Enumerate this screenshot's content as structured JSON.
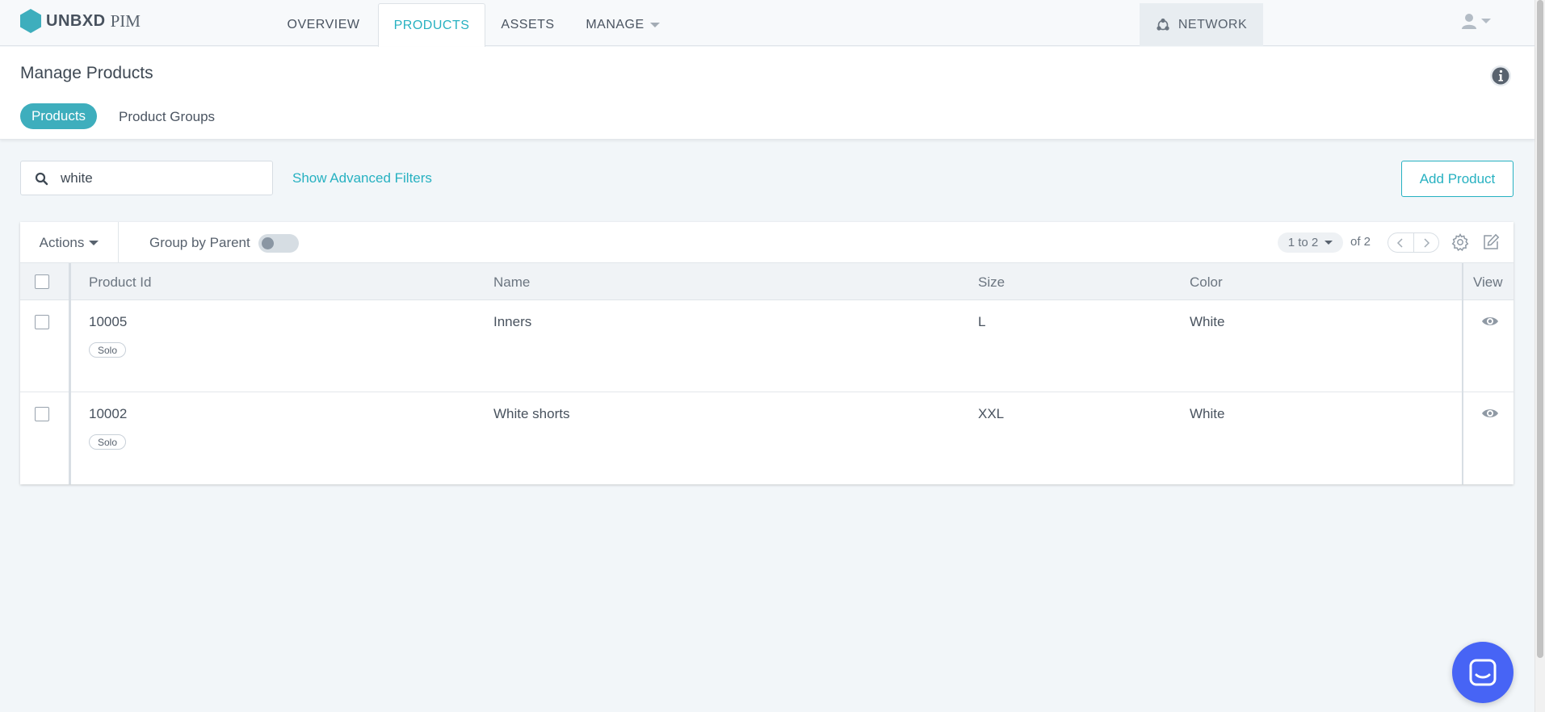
{
  "topnav": {
    "brand": "UNBXD",
    "product": "PIM",
    "tabs": [
      {
        "label": "OVERVIEW"
      },
      {
        "label": "PRODUCTS"
      },
      {
        "label": "ASSETS"
      },
      {
        "label": "MANAGE"
      }
    ],
    "active_tab": "PRODUCTS",
    "network_label": "NETWORK",
    "accent_color": "#27b1c1",
    "brand_color": "#3eaebd"
  },
  "header": {
    "title": "Manage Products",
    "subtabs": [
      {
        "label": "Products"
      },
      {
        "label": "Product Groups"
      }
    ],
    "active_subtab": "Products"
  },
  "filters": {
    "search_value": "white",
    "advanced_filters_label": "Show Advanced Filters",
    "add_button_label": "Add Product"
  },
  "grid": {
    "actions_label": "Actions",
    "group_by_label": "Group by Parent",
    "group_by_enabled": false,
    "range_label": "1 to 2",
    "total_label": "of 2",
    "columns": [
      {
        "label": "Product Id"
      },
      {
        "label": "Name"
      },
      {
        "label": "Size"
      },
      {
        "label": "Color"
      },
      {
        "label": "View"
      }
    ],
    "rows": [
      {
        "id": "10005",
        "badge": "Solo",
        "name": "Inners",
        "size": "L",
        "color": "White"
      },
      {
        "id": "10002",
        "badge": "Solo",
        "name": "White shorts",
        "size": "XXL",
        "color": "White"
      }
    ]
  },
  "icons": {
    "logo": "hexagon-logo-icon",
    "network": "network-icon",
    "user": "user-icon",
    "info": "info-icon",
    "search": "search-icon",
    "settings": "gear-icon",
    "edit": "edit-icon",
    "view": "eye-icon",
    "chat": "chat-icon"
  }
}
